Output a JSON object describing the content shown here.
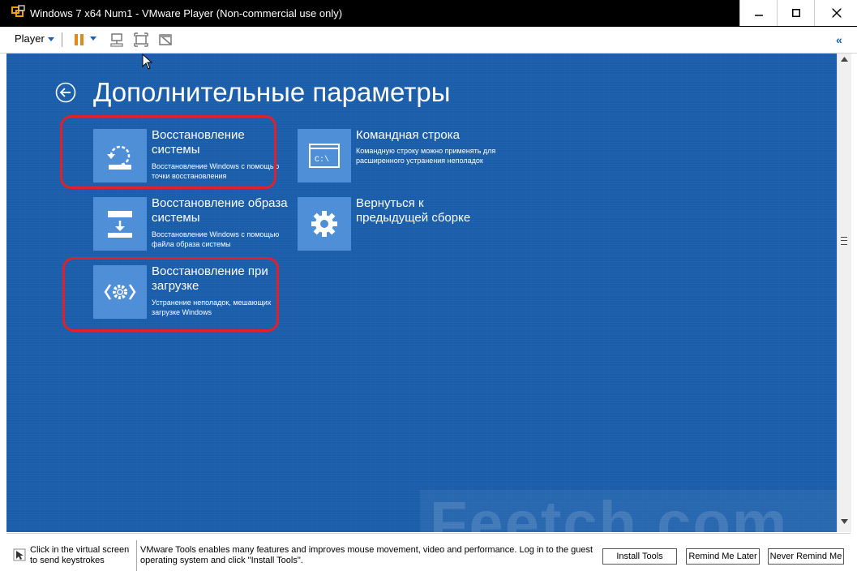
{
  "window": {
    "title": "Windows 7 x64 Num1 - VMware Player (Non-commercial use only)"
  },
  "toolbar": {
    "player_label": "Player"
  },
  "screen": {
    "title": "Дополнительные параметры",
    "tiles": [
      {
        "title": "Восстановление системы",
        "desc": "Восстановление Windows с помощью точки восстановления",
        "icon": "system-restore-icon",
        "highlighted": true
      },
      {
        "title": "Командная строка",
        "desc": "Командную строку можно применять для расширенного устранения неполадок",
        "icon": "command-prompt-icon",
        "highlighted": false
      },
      {
        "title": "Восстановление образа системы",
        "desc": "Восстановление Windows с помощью файла образа системы",
        "icon": "image-restore-icon",
        "highlighted": false
      },
      {
        "title": "Вернуться к предыдущей сборке",
        "desc": "",
        "icon": "gear-icon",
        "highlighted": false
      },
      {
        "title": "Восстановление при загрузке",
        "desc": "Устранение неполадок, мешающих загрузке Windows",
        "icon": "startup-repair-icon",
        "highlighted": true
      }
    ],
    "watermark": "Feetch.com"
  },
  "hintbar": {
    "left_text": "Click in the virtual screen to send keystrokes",
    "message": "VMware Tools enables many features and improves mouse movement, video and performance. Log in to the guest operating system and click \"Install Tools\".",
    "install_label": "Install Tools",
    "later_label": "Remind Me Later",
    "never_label": "Never Remind Me"
  },
  "colors": {
    "screen_bg": "#1b5fac",
    "tile_icon_bg": "#4e8fd7",
    "highlight": "#e0202a"
  }
}
